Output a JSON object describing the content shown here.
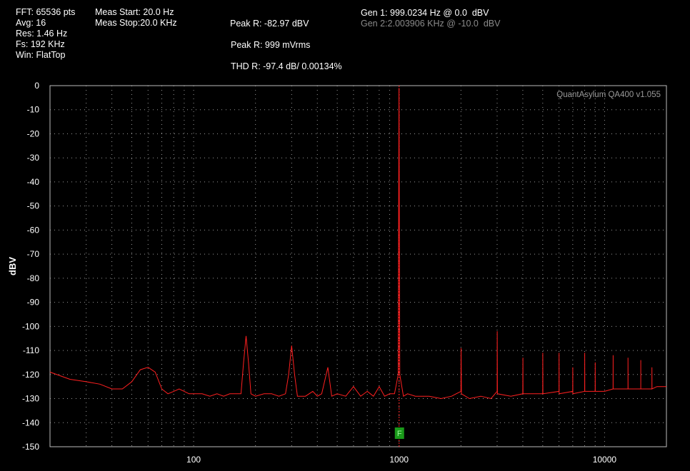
{
  "info": {
    "fft": "FFT: 65536 pts",
    "avg": "Avg: 16",
    "res": "Res: 1.46 Hz",
    "fs": "Fs: 192 KHz",
    "win": "Win: FlatTop",
    "meas_start": "Meas Start: 20.0 Hz",
    "meas_stop": "Meas Stop:20.0 KHz",
    "peak_dbv": "Peak R: -82.97 dBV",
    "peak_rms": "Peak R: 999 mVrms",
    "thd": "THD R: -97.4 dB/ 0.00134%",
    "gen1": "Gen 1: 999.0234 Hz @ 0.0  dBV",
    "gen2": "Gen 2:2.003906 KHz @ -10.0  dBV"
  },
  "watermark": "QuantAsylum QA400 v1.055",
  "marker_label": "F",
  "colors": {
    "trace": "#ff2020",
    "grid": "#9a9a9a",
    "marker": "#1a9a1a",
    "background": "#000000"
  },
  "chart_data": {
    "type": "line",
    "ylabel": "dBV",
    "xlabel": "",
    "xscale": "log",
    "xlim": [
      20,
      20000
    ],
    "ylim": [
      -150,
      0
    ],
    "yticks": [
      0,
      -10,
      -20,
      -30,
      -40,
      -50,
      -60,
      -70,
      -80,
      -90,
      -100,
      -110,
      -120,
      -130,
      -140,
      -150
    ],
    "xtick_labels": [
      {
        "x": 100,
        "label": "100"
      },
      {
        "x": 1000,
        "label": "1000"
      },
      {
        "x": 10000,
        "label": "10000"
      }
    ],
    "grid": true,
    "marker": {
      "x": 1000,
      "label": "F"
    },
    "series": [
      {
        "points": [
          [
            20,
            -119
          ],
          [
            25,
            -122
          ],
          [
            30,
            -123
          ],
          [
            35,
            -124
          ],
          [
            40,
            -126
          ],
          [
            45,
            -126
          ],
          [
            50,
            -123
          ],
          [
            55,
            -118
          ],
          [
            60,
            -117
          ],
          [
            65,
            -119
          ],
          [
            70,
            -126
          ],
          [
            75,
            -128
          ],
          [
            80,
            -127
          ],
          [
            85,
            -126
          ],
          [
            90,
            -127
          ],
          [
            95,
            -128
          ],
          [
            100,
            -128
          ],
          [
            110,
            -128
          ],
          [
            120,
            -129
          ],
          [
            130,
            -128
          ],
          [
            140,
            -129
          ],
          [
            150,
            -128
          ],
          [
            160,
            -128
          ],
          [
            170,
            -128
          ],
          [
            175,
            -115
          ],
          [
            180,
            -104
          ],
          [
            185,
            -115
          ],
          [
            190,
            -128
          ],
          [
            200,
            -129
          ],
          [
            220,
            -128
          ],
          [
            240,
            -128
          ],
          [
            260,
            -129
          ],
          [
            280,
            -128
          ],
          [
            290,
            -120
          ],
          [
            300,
            -108
          ],
          [
            310,
            -120
          ],
          [
            320,
            -129
          ],
          [
            350,
            -129
          ],
          [
            380,
            -127
          ],
          [
            400,
            -129
          ],
          [
            420,
            -128
          ],
          [
            450,
            -117
          ],
          [
            470,
            -129
          ],
          [
            500,
            -128
          ],
          [
            550,
            -129
          ],
          [
            600,
            -125
          ],
          [
            650,
            -129
          ],
          [
            700,
            -127
          ],
          [
            750,
            -129
          ],
          [
            800,
            -125
          ],
          [
            850,
            -129
          ],
          [
            900,
            -128
          ],
          [
            950,
            -128
          ],
          [
            990,
            -120
          ],
          [
            999,
            -1
          ],
          [
            1008,
            -120
          ],
          [
            1050,
            -129
          ],
          [
            1100,
            -128
          ],
          [
            1200,
            -129
          ],
          [
            1400,
            -129
          ],
          [
            1600,
            -130
          ],
          [
            1800,
            -129
          ],
          [
            2000,
            -127
          ],
          [
            2003,
            -109
          ],
          [
            2010,
            -128
          ],
          [
            2200,
            -130
          ],
          [
            2500,
            -129
          ],
          [
            2800,
            -130
          ],
          [
            3000,
            -127
          ],
          [
            3003,
            -102
          ],
          [
            3010,
            -128
          ],
          [
            3500,
            -129
          ],
          [
            4000,
            -128
          ],
          [
            4005,
            -113
          ],
          [
            4010,
            -128
          ],
          [
            5000,
            -128
          ],
          [
            5005,
            -111
          ],
          [
            5010,
            -128
          ],
          [
            6000,
            -127
          ],
          [
            6005,
            -111
          ],
          [
            6010,
            -128
          ],
          [
            7000,
            -127
          ],
          [
            7005,
            -117
          ],
          [
            7010,
            -128
          ],
          [
            8000,
            -127
          ],
          [
            8005,
            -111
          ],
          [
            8010,
            -127
          ],
          [
            9000,
            -127
          ],
          [
            9005,
            -115
          ],
          [
            9010,
            -127
          ],
          [
            10000,
            -127
          ],
          [
            11000,
            -126
          ],
          [
            11005,
            -112
          ],
          [
            11010,
            -126
          ],
          [
            12000,
            -126
          ],
          [
            13000,
            -126
          ],
          [
            13005,
            -113
          ],
          [
            13010,
            -126
          ],
          [
            15000,
            -126
          ],
          [
            15005,
            -114
          ],
          [
            15010,
            -126
          ],
          [
            17000,
            -126
          ],
          [
            17005,
            -117
          ],
          [
            17010,
            -126
          ],
          [
            18000,
            -125
          ],
          [
            19000,
            -125
          ],
          [
            20000,
            -125
          ]
        ]
      }
    ]
  }
}
